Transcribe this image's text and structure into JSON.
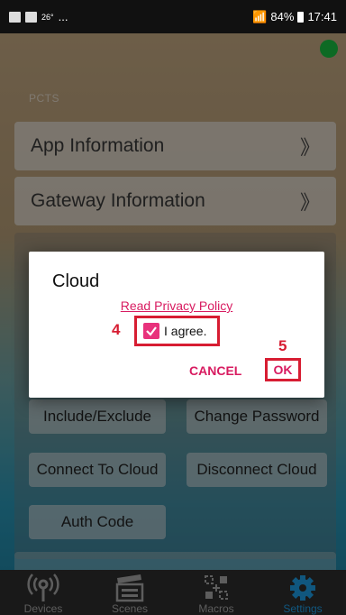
{
  "status_bar": {
    "temperature": "26°",
    "overflow": "...",
    "battery": "84%",
    "time": "17:41"
  },
  "section_label": "PCTS",
  "menu": [
    {
      "label": "App Information",
      "chevron": "》"
    },
    {
      "label": "Gateway Information",
      "chevron": "》"
    }
  ],
  "buttons": {
    "include_exclude": "Include/Exclude",
    "change_password": "Change Password",
    "connect_cloud": "Connect To Cloud",
    "disconnect_cloud": "Disconnect Cloud",
    "auth_code": "Auth Code"
  },
  "dialog": {
    "title": "Cloud",
    "privacy_link": "Read Privacy Policy",
    "agree_label": "I agree.",
    "agree_checked": true,
    "cancel": "CANCEL",
    "ok": "OK",
    "step_agree": "4",
    "step_ok": "5"
  },
  "bottom_nav": [
    {
      "label": "Devices",
      "icon": "antenna-icon"
    },
    {
      "label": "Scenes",
      "icon": "clapperboard-icon"
    },
    {
      "label": "Macros",
      "icon": "macro-grid-icon"
    },
    {
      "label": "Settings",
      "icon": "gear-icon",
      "active": true
    }
  ],
  "colors": {
    "accent": "#d81b60",
    "annotation": "#d71d32",
    "nav_active": "#1e9ee8",
    "status_online": "#19c142"
  }
}
